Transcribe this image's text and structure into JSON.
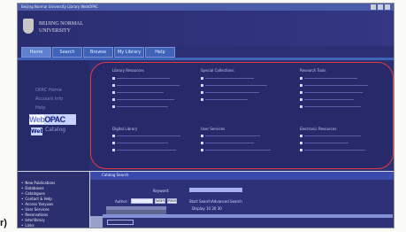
{
  "window": {
    "title": "Beijing Normal University Library WebOPAC"
  },
  "header": {
    "logo_line_1": "BEIJING NORMAL",
    "logo_line_2": "UNIVERSITY"
  },
  "tabs": [
    {
      "label": "Home"
    },
    {
      "label": "Search"
    },
    {
      "label": "Browse"
    },
    {
      "label": "My Library"
    },
    {
      "label": "Help"
    }
  ],
  "sidebar": {
    "links": [
      {
        "label": "OPAC Home"
      },
      {
        "label": "Account Info"
      },
      {
        "label": "Help"
      }
    ],
    "brand_web": "Web",
    "brand_opac": "OPAC",
    "brand_small": "Web",
    "brand_small_word": "Catalog"
  },
  "catalog": {
    "sections": [
      {
        "title": "Library Resources"
      },
      {
        "title": "Special Collections"
      },
      {
        "title": "Research Tools"
      },
      {
        "title": "Digital Library"
      },
      {
        "title": "User Services"
      },
      {
        "title": "Electronic Resources"
      }
    ]
  },
  "left_list": [
    {
      "label": "New Publications"
    },
    {
      "label": "Databases"
    },
    {
      "label": "Catalogues"
    },
    {
      "label": "Contact & Help"
    },
    {
      "label": "Access Yanyuan"
    },
    {
      "label": "User Services"
    },
    {
      "label": "Reservations"
    },
    {
      "label": "Interlibrary"
    },
    {
      "label": "Links"
    }
  ],
  "bottom_form": {
    "title": "Catalog Search",
    "keyword_label": "Keyword:",
    "author_label": "Author:",
    "start_label": "Start Search",
    "advanced_label": "Advanced Search",
    "search_button": "Search",
    "reset_button": "Reset",
    "summary": "Display 10 20 30"
  },
  "footnote": {
    "label": "r)"
  }
}
